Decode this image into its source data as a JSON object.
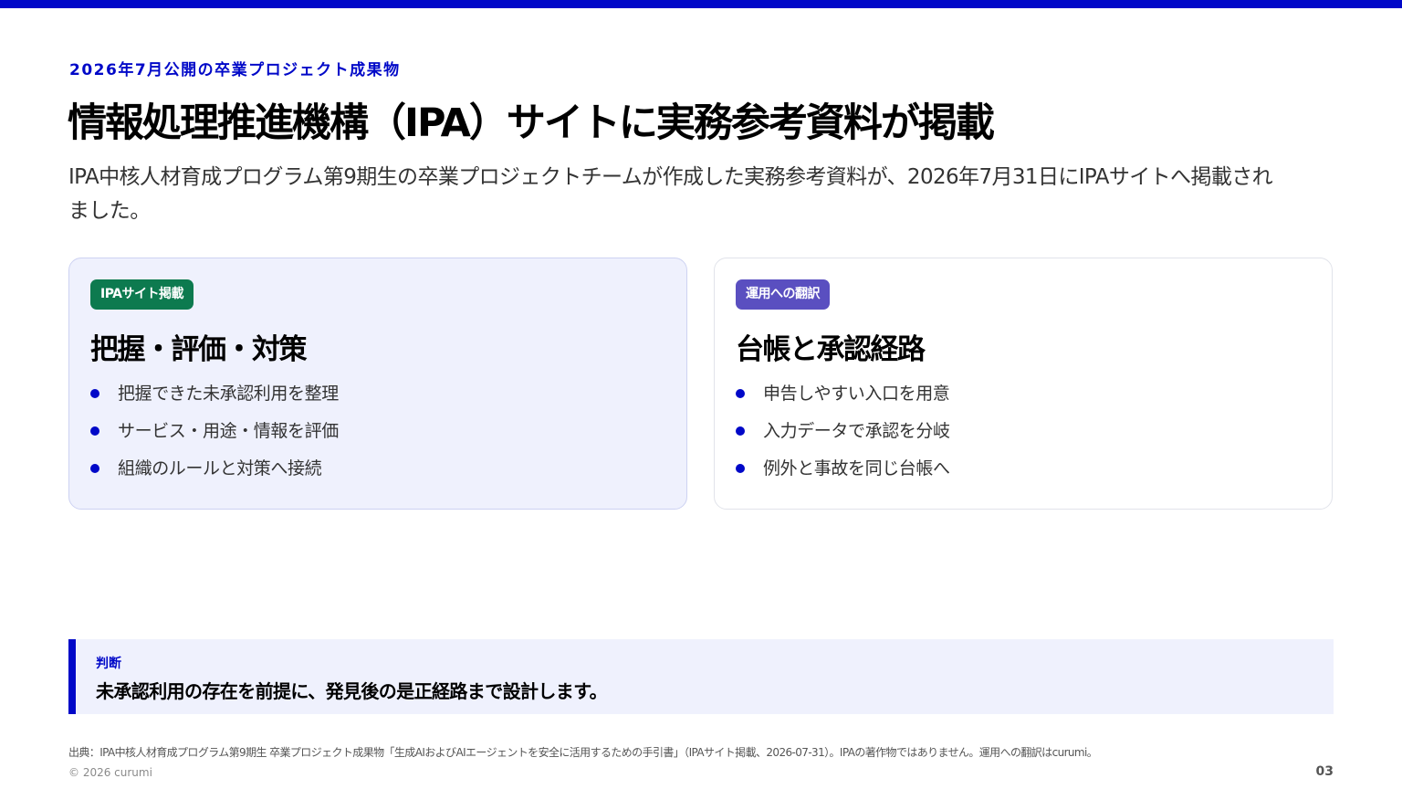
{
  "colors": {
    "accent": "#0008c8",
    "badge_green": "#0d7a4f",
    "badge_purple": "#5a4fc0",
    "panel_tint": "#eff1fd"
  },
  "eyebrow": "2026年7月公開の卒業プロジェクト成果物",
  "title": "情報処理推進機構（IPA）サイトに実務参考資料が掲載",
  "lead": "IPA中核人材育成プログラム第9期生の卒業プロジェクトチームが作成した実務参考資料が、2026年7月31日にIPAサイトへ掲載されました。",
  "cards": [
    {
      "badge": "IPAサイト掲載",
      "title": "把握・評価・対策",
      "items": [
        "把握できた未承認利用を整理",
        "サービス・用途・情報を評価",
        "組織のルールと対策へ接続"
      ]
    },
    {
      "badge": "運用への翻訳",
      "title": "台帳と承認経路",
      "items": [
        "申告しやすい入口を用意",
        "入力データで承認を分岐",
        "例外と事故を同じ台帳へ"
      ]
    }
  ],
  "callout": {
    "label": "判断",
    "text": "未承認利用の存在を前提に、発見後の是正経路まで設計します。"
  },
  "footer": {
    "source": "出典：IPA中核人材育成プログラム第9期生 卒業プロジェクト成果物「生成AIおよびAIエージェントを安全に活用するための手引書」（IPAサイト掲載、2026-07-31）。IPAの著作物ではありません。運用への翻訳はcurumi。",
    "copyright": "© 2026 curumi",
    "page": "03"
  }
}
